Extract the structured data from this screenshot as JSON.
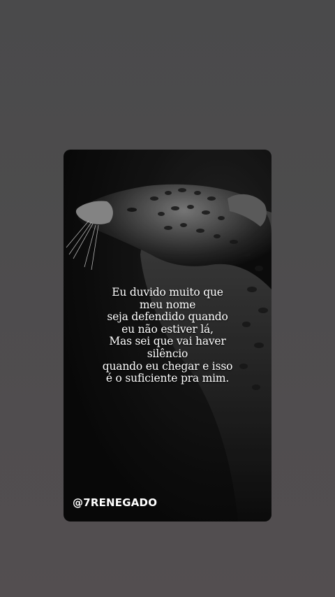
{
  "post": {
    "quote_lines": [
      "Eu duvido muito que",
      "meu nome",
      "seja defendido quando",
      "eu não estiver lá,",
      "Mas sei que vai haver",
      "silêncio",
      "quando eu chegar e isso",
      "é o suficiente pra mim."
    ],
    "handle": "@7RENEGADO",
    "image_subject": "leopard-image"
  },
  "colors": {
    "background": "#4c4b4c",
    "card": "#111111",
    "text": "#ffffff"
  }
}
